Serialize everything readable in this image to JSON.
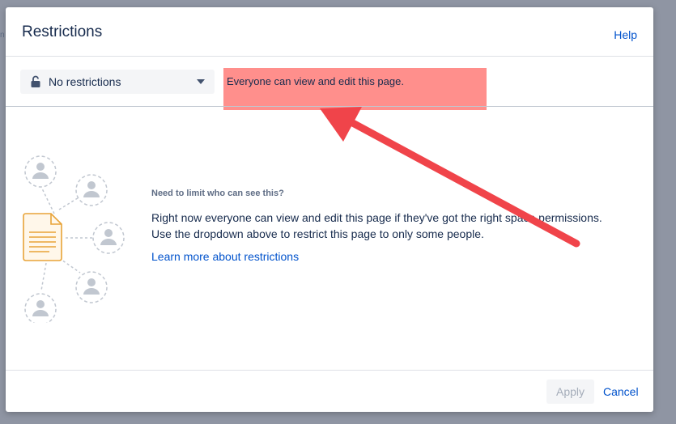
{
  "background": {
    "fragment": "n"
  },
  "dialog": {
    "title": "Restrictions",
    "help_label": "Help"
  },
  "toolbar": {
    "select_value": "No restrictions",
    "select_icon": "unlock-icon",
    "status_text": "Everyone can view and edit this page."
  },
  "annotation": {
    "highlight_color": "#ff8f8c",
    "arrow_color": "#f0444a"
  },
  "info": {
    "heading": "Need to limit who can see this?",
    "line1": "Right now everyone can view and edit this page if they've got the right space permissions.",
    "line2": "Use the dropdown above to restrict this page to only some people.",
    "learn_more": "Learn more about restrictions"
  },
  "footer": {
    "apply_label": "Apply",
    "cancel_label": "Cancel"
  },
  "colors": {
    "link": "#0052cc",
    "text": "#172b4d",
    "document_icon": "#e8a338"
  }
}
